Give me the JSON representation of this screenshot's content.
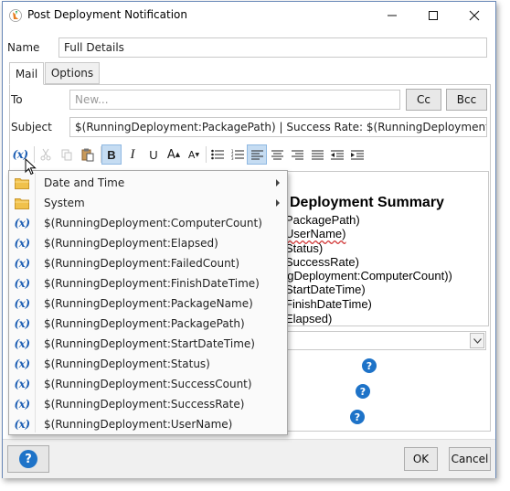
{
  "window": {
    "title": "Post Deployment Notification"
  },
  "form": {
    "name_label": "Name",
    "name_value": "Full Details",
    "to_label": "To",
    "to_placeholder": "New...",
    "cc_label": "Cc",
    "bcc_label": "Bcc",
    "subject_label": "Subject",
    "subject_value": "$(RunningDeployment:PackagePath) | Success Rate: $(RunningDeployment:SuccessR"
  },
  "tabs": [
    {
      "label": "Mail",
      "active": true
    },
    {
      "label": "Options",
      "active": false
    }
  ],
  "toolbar": {
    "insert_variable": "(x)",
    "bold": "B",
    "italic": "I",
    "underline": "U",
    "grow_font": "A",
    "shrink_font": "A"
  },
  "editor": {
    "heading": "Deployment Summary",
    "lines": [
      "PackagePath)",
      "UserName)",
      "Status)",
      "SuccessRate)",
      "ngDeployment:ComputerCount))",
      "StartDateTime)",
      "FinishDateTime)",
      "Elapsed)"
    ]
  },
  "menu": {
    "folders": [
      {
        "label": "Date and Time",
        "icon": "folder-icon"
      },
      {
        "label": "System",
        "icon": "folder-icon"
      }
    ],
    "variables": [
      "$(RunningDeployment:ComputerCount)",
      "$(RunningDeployment:Elapsed)",
      "$(RunningDeployment:FailedCount)",
      "$(RunningDeployment:FinishDateTime)",
      "$(RunningDeployment:PackageName)",
      "$(RunningDeployment:PackagePath)",
      "$(RunningDeployment:StartDateTime)",
      "$(RunningDeployment:Status)",
      "$(RunningDeployment:SuccessCount)",
      "$(RunningDeployment:SuccessRate)",
      "$(RunningDeployment:UserName)"
    ],
    "variable_icon": "(x)"
  },
  "help_marker": "?",
  "footer": {
    "help_label": "?",
    "ok_label": "OK",
    "cancel_label": "Cancel"
  },
  "colors": {
    "accent": "#1e73c8",
    "variable_icon": "#1e5fb4",
    "folder": "#f0c14b",
    "toolbar_active": "#c5dcf2",
    "spell_error": "#d23b3b"
  }
}
